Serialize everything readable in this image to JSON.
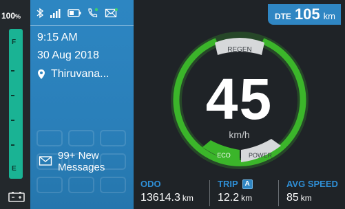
{
  "battery": {
    "percent_text": "100",
    "percent_unit": "%",
    "level": 1.0,
    "full_letter": "F",
    "empty_letter": "E",
    "fill_color": "#1ab394",
    "icon": "battery-charge-icon"
  },
  "status_bar": {
    "icons": [
      "bluetooth-icon",
      "signal-bars-icon",
      "battery-status-icon",
      "phone-call-icon",
      "mail-icon"
    ]
  },
  "info": {
    "time": "9:15 AM",
    "date": "30 Aug 2018",
    "location": "Thiruvana...",
    "location_icon": "location-pin-icon",
    "messages_line1": "99+ New",
    "messages_line2": "Messages",
    "messages_icon": "envelope-icon",
    "panel_color": "#2d86c2"
  },
  "dte": {
    "label": "DTE",
    "value": "105",
    "unit": "km"
  },
  "gauge": {
    "speed": "45",
    "unit": "km/h",
    "regen_label": "REGEN",
    "eco_label": "ECO",
    "power_label": "POWER",
    "active_mode": "ECO",
    "arc_color": "#3bb52a"
  },
  "stats": {
    "odo_label": "ODO",
    "odo_value": "13614.3",
    "odo_unit": "km",
    "trip_label": "TRIP",
    "trip_badge": "A",
    "trip_value": "12.2",
    "trip_unit": "km",
    "avg_label": "AVG SPEED",
    "avg_value": "85",
    "avg_unit": "km"
  }
}
